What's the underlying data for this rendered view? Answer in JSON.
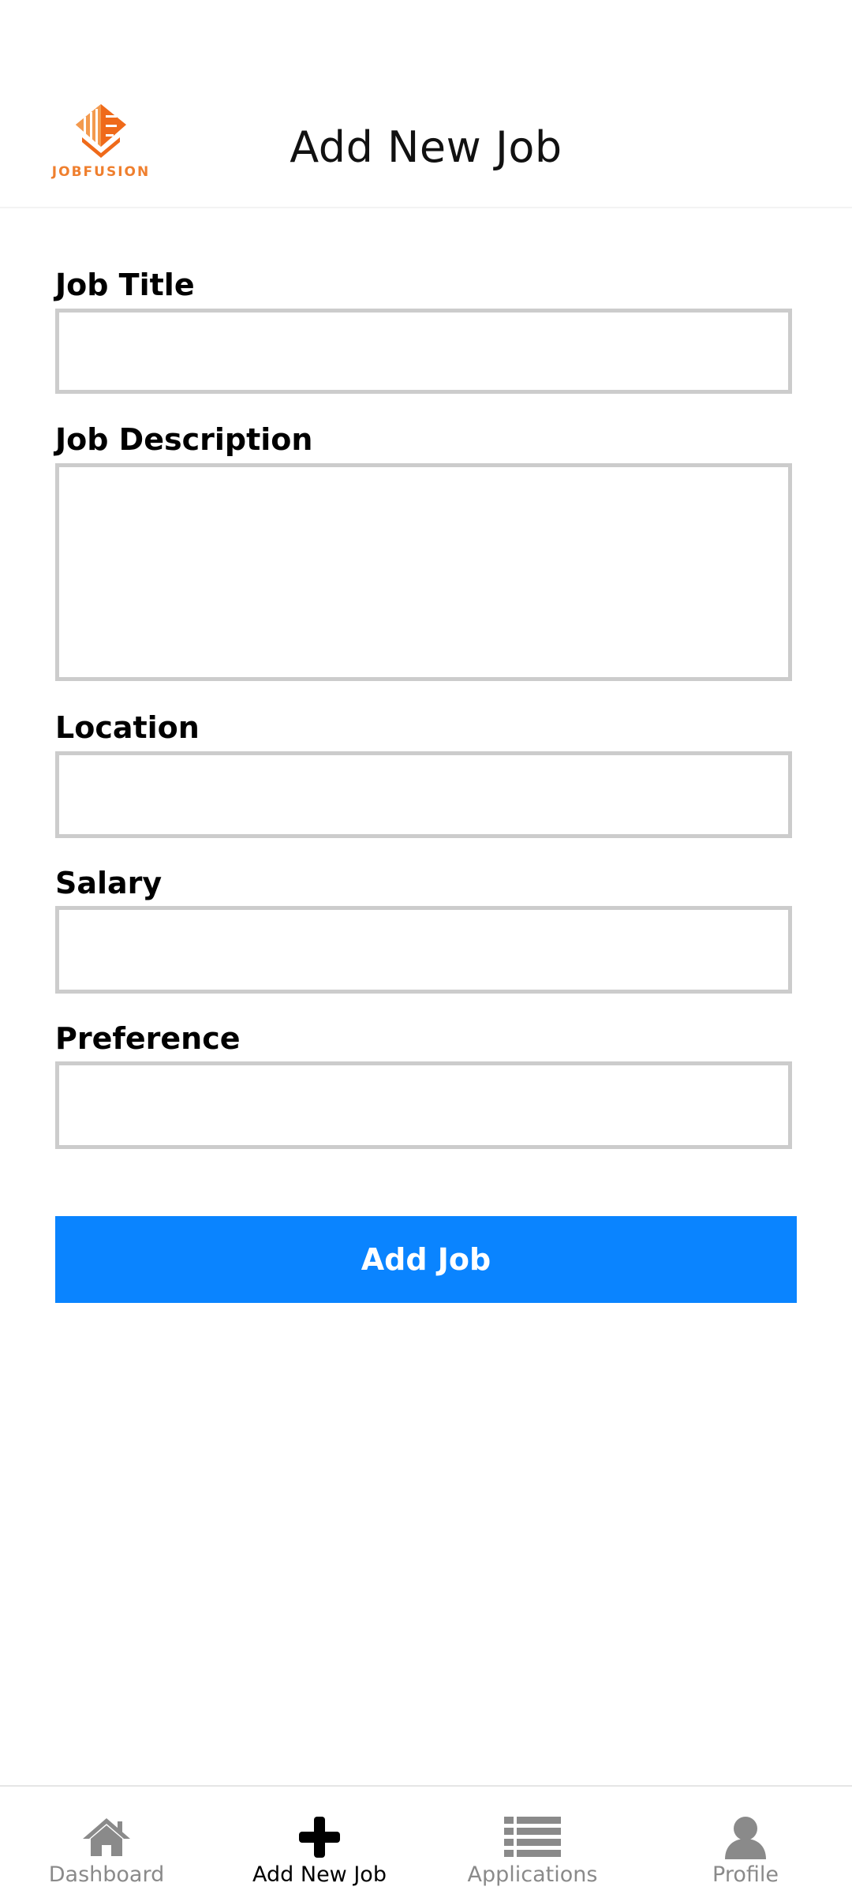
{
  "header": {
    "logo_text": "JOBFUSION",
    "title": "Add New Job"
  },
  "form": {
    "job_title_label": "Job Title",
    "job_title_value": "",
    "job_description_label": "Job Description",
    "job_description_value": "",
    "location_label": "Location",
    "location_value": "",
    "salary_label": "Salary",
    "salary_value": "",
    "preference_label": "Preference",
    "preference_value": "",
    "submit_label": "Add Job"
  },
  "nav": {
    "items": [
      {
        "label": "Dashboard",
        "icon": "home-icon",
        "active": false
      },
      {
        "label": "Add New Job",
        "icon": "plus-icon",
        "active": true
      },
      {
        "label": "Applications",
        "icon": "list-icon",
        "active": false
      },
      {
        "label": "Profile",
        "icon": "user-icon",
        "active": false
      }
    ]
  },
  "colors": {
    "brand_orange": "#ef7f2e",
    "primary_button": "#0a84ff",
    "input_border": "#cccccc",
    "nav_inactive": "#8a8a8a",
    "nav_active": "#000000"
  }
}
